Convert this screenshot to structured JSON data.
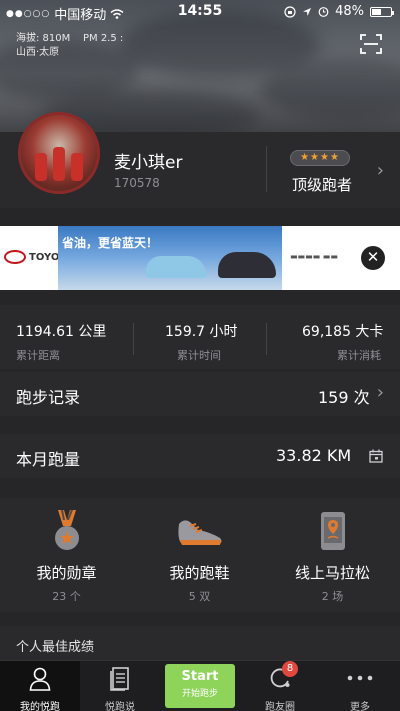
{
  "status_bar": {
    "signal": "●●○○○",
    "carrier": "中国移动",
    "time": "14:55",
    "battery": "48%"
  },
  "location": {
    "altitude": "海拔:  810M",
    "pm25": "PM 2.5 :",
    "city": "山西·太原"
  },
  "profile": {
    "name": "麦小琪er",
    "user_id": "170578",
    "stars": "★★★★",
    "rank": "顶级跑者"
  },
  "ad": {
    "brand": "TOYOTA",
    "slogan": "省油，更省蓝天！",
    "close": "✕"
  },
  "stats": [
    {
      "value": "1194.61 公里",
      "label": "累计距离"
    },
    {
      "value": "159.7 小时",
      "label": "累计时间"
    },
    {
      "value": "69,185 大卡",
      "label": "累计消耗"
    }
  ],
  "run_records": {
    "label": "跑步记录",
    "value": "159 次"
  },
  "monthly": {
    "label": "本月跑量",
    "value": "33.82  KM"
  },
  "features": [
    {
      "title": "我的勋章",
      "count": "23 个"
    },
    {
      "title": "我的跑鞋",
      "count": "5 双"
    },
    {
      "title": "线上马拉松",
      "count": "2 场"
    }
  ],
  "personal_best": {
    "label": "个人最佳成绩"
  },
  "tabs": [
    {
      "label": "我的悦跑"
    },
    {
      "label": "悦跑说"
    },
    {
      "label": "跑友圈",
      "badge": "8"
    },
    {
      "label": "更多"
    }
  ],
  "start": {
    "label": "Start",
    "sub": "开始跑步"
  },
  "colors": {
    "accent_green": "#8ed35a",
    "badge_red": "#e0483e",
    "rank_gold": "#f0a030"
  }
}
